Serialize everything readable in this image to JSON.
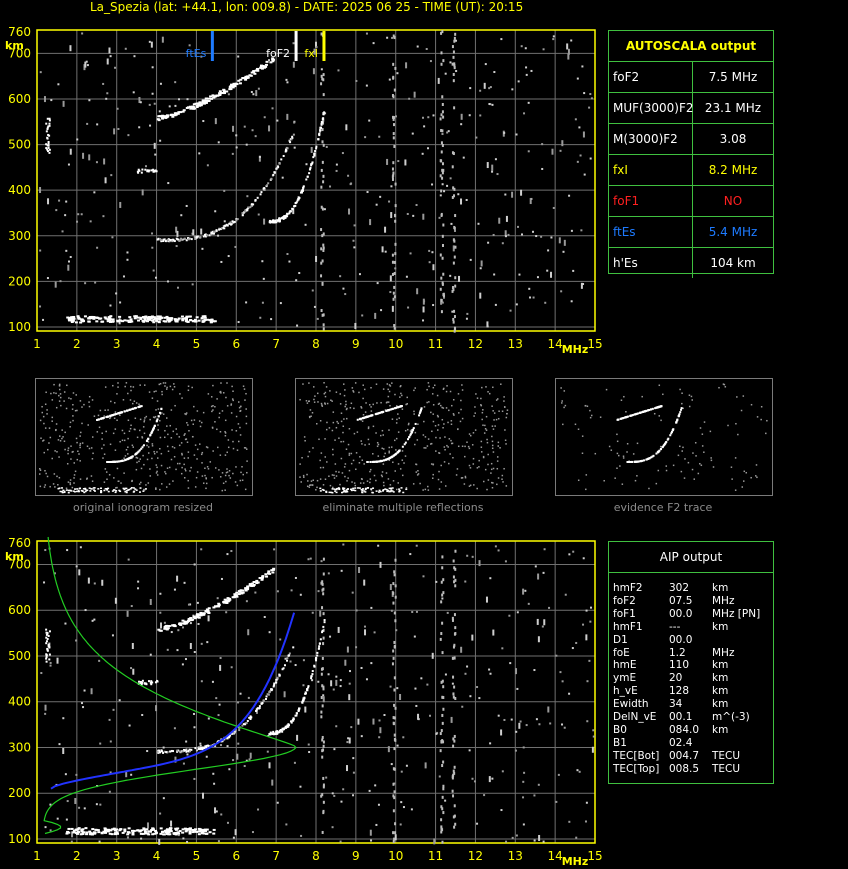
{
  "header": {
    "title": "La_Spezia (lat: +44.1, lon: 009.8) - DATE: 2025 06 25 - TIME (UT): 20:15"
  },
  "axes": {
    "y_unit": "km",
    "x_unit": "MHz",
    "y_ticks": [
      "760",
      "700",
      "600",
      "500",
      "400",
      "300",
      "200",
      "100"
    ],
    "x_ticks": [
      "1",
      "2",
      "3",
      "4",
      "5",
      "6",
      "7",
      "8",
      "9",
      "10",
      "11",
      "12",
      "13",
      "14",
      "15"
    ]
  },
  "markers": [
    {
      "label": "ftEs",
      "freq_mhz": 5.4,
      "color": "#1e7bff"
    },
    {
      "label": "foF2",
      "freq_mhz": 7.5,
      "color": "#ffffff"
    },
    {
      "label": "fxI",
      "freq_mhz": 8.2,
      "color": "#ffff00"
    }
  ],
  "autoscala": {
    "title": "AUTOSCALA output",
    "rows": [
      {
        "key": "foF2",
        "value": "7.5 MHz",
        "key_color": "#ffffff",
        "value_color": "#ffffff"
      },
      {
        "key": "MUF(3000)F2",
        "value": "23.1 MHz",
        "key_color": "#ffffff",
        "value_color": "#ffffff"
      },
      {
        "key": "M(3000)F2",
        "value": "3.08",
        "key_color": "#ffffff",
        "value_color": "#ffffff"
      },
      {
        "key": "fxI",
        "value": "8.2 MHz",
        "key_color": "#ffff00",
        "value_color": "#ffff00"
      },
      {
        "key": "foF1",
        "value": "NO",
        "key_color": "#ff2020",
        "value_color": "#ff2020"
      },
      {
        "key": "ftEs",
        "value": "5.4 MHz",
        "key_color": "#1e7bff",
        "value_color": "#1e7bff"
      },
      {
        "key": "h'Es",
        "value": "104     km",
        "key_color": "#ffffff",
        "value_color": "#ffffff"
      }
    ]
  },
  "thumbnails": [
    {
      "label": "original ionogram resized"
    },
    {
      "label": "eliminate multiple reflections"
    },
    {
      "label": "evidence F2 trace"
    }
  ],
  "aip": {
    "title": "AIP output",
    "rows": [
      [
        "hmF2",
        "302",
        "km"
      ],
      [
        "foF2",
        "07.5",
        "MHz"
      ],
      [
        "foF1",
        "00.0",
        "MHz  [PN]"
      ],
      [
        "hmF1",
        "---",
        "km"
      ],
      [
        "D1",
        "00.0",
        ""
      ],
      [
        "foE",
        "1.2",
        "MHz"
      ],
      [
        "hmE",
        "110",
        "km"
      ],
      [
        "ymE",
        "20",
        "km"
      ],
      [
        "h_vE",
        "128",
        "km"
      ],
      [
        "Ewidth",
        "34",
        "km"
      ],
      [
        "DelN_vE",
        "00.1",
        "m^(-3)"
      ],
      [
        "B0",
        "084.0",
        "km"
      ],
      [
        "B1",
        "02.4",
        ""
      ],
      [
        "TEC[Bot]",
        "004.7",
        "TECU"
      ],
      [
        "TEC[Top]",
        "008.5",
        "TECU"
      ]
    ]
  },
  "colors": {
    "grid": "#707070",
    "axis": "#ffff00",
    "panel_border": "#3fbf3f",
    "profile": "#22cc22",
    "trace": "#2233ff"
  }
}
